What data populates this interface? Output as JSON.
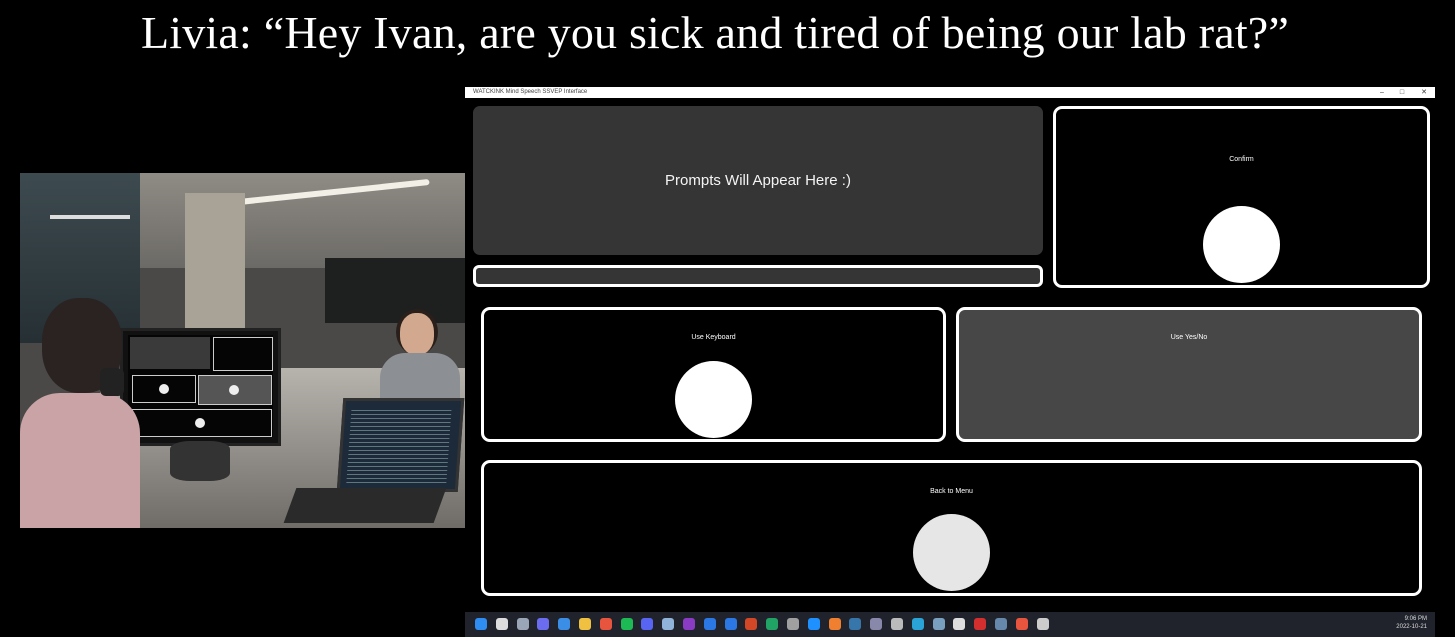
{
  "caption": "Livia: “Hey Ivan, are you sick and tired of being our lab rat?”",
  "window": {
    "title": "WATCKINK Mind Speech SSVEP Interface",
    "controls": {
      "minimize": "–",
      "maximize": "□",
      "close": "✕"
    }
  },
  "prompt_text": "Prompts Will Appear Here :)",
  "progress": {
    "value": 0
  },
  "panels": {
    "confirm": {
      "label": "Confirm"
    },
    "keyboard": {
      "label": "Use Keyboard"
    },
    "yesno": {
      "label": "Use Yes/No"
    },
    "back": {
      "label": "Back to Menu"
    }
  },
  "taskbar": {
    "time": "9:06 PM",
    "date": "2022-10-21",
    "icons": [
      "start-icon",
      "search-icon",
      "task-view-icon",
      "chat-icon",
      "widgets-icon",
      "file-explorer-icon",
      "chrome-icon",
      "spotify-icon",
      "discord-icon",
      "notepad-icon",
      "onenote-icon",
      "word-icon",
      "browser-icon",
      "powerpoint-icon",
      "excel-icon",
      "git-icon",
      "vscode-icon",
      "matlab-icon",
      "python-icon",
      "app-icon",
      "settings-icon",
      "edge-icon",
      "app2-icon",
      "media-icon",
      "acrobat-icon",
      "steam-icon",
      "chrome2-icon",
      "terminal-icon"
    ],
    "icon_colors": [
      "#2f8cf0",
      "#dddddd",
      "#9aa6b8",
      "#6c6cf0",
      "#3a8ee6",
      "#f0c040",
      "#e8553e",
      "#1db954",
      "#5865f2",
      "#8fb3d9",
      "#8a3bc4",
      "#2b78e4",
      "#2b78e4",
      "#d24726",
      "#21a366",
      "#a0a0a0",
      "#1e90ff",
      "#f08030",
      "#3776ab",
      "#8888aa",
      "#bbbbbb",
      "#2aa3d6",
      "#7aa0c0",
      "#dddddd",
      "#d32f2f",
      "#6688aa",
      "#e8553e",
      "#cccccc"
    ]
  }
}
